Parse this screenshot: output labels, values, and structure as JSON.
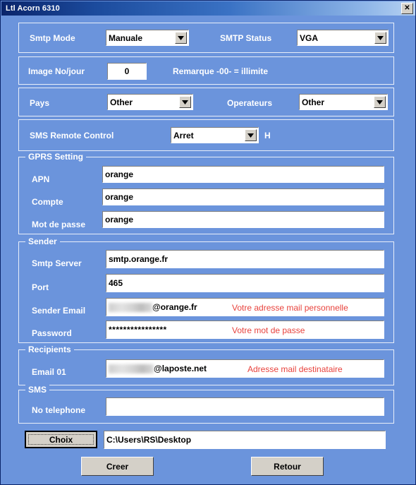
{
  "window": {
    "title": "Ltl Acorn 6310",
    "close_label": "✕",
    "bg_color": "#6b94dc",
    "accent_red": "#e8423c"
  },
  "smtp_mode": {
    "label": "Smtp Mode",
    "value": "Manuale"
  },
  "smtp_status": {
    "label": "SMTP Status",
    "value": "VGA"
  },
  "image_per_day": {
    "label": "Image No/jour",
    "value": "0",
    "remark": "Remarque -00- = illimite"
  },
  "pays": {
    "label": "Pays",
    "value": "Other"
  },
  "operateurs": {
    "label": "Operateurs",
    "value": "Other"
  },
  "sms_remote": {
    "label": "SMS Remote Control",
    "value": "Arret",
    "unit": "H"
  },
  "gprs": {
    "caption": "GPRS Setting",
    "apn": {
      "label": "APN",
      "value": "orange"
    },
    "compte": {
      "label": "Compte",
      "value": "orange"
    },
    "mot_de_passe": {
      "label": "Mot de passe",
      "value": "orange"
    }
  },
  "sender": {
    "caption": "Sender",
    "smtp_server": {
      "label": "Smtp Server",
      "value": "smtp.orange.fr"
    },
    "port": {
      "label": "Port",
      "value": "465"
    },
    "sender_email": {
      "label": "Sender Email",
      "value": "@orange.fr",
      "hint": "Votre adresse mail personnelle"
    },
    "password": {
      "label": "Password",
      "value": "****************",
      "hint": "Votre mot de passe"
    }
  },
  "recipients": {
    "caption": "Recipients",
    "email01": {
      "label": "Email 01",
      "value": "@laposte.net",
      "hint": "Adresse mail destinataire"
    }
  },
  "sms": {
    "caption": "SMS",
    "phone": {
      "label": "No telephone",
      "value": ""
    }
  },
  "path": {
    "choix_label": "Choix",
    "value": "C:\\Users\\RS\\Desktop"
  },
  "actions": {
    "creer_label": "Creer",
    "retour_label": "Retour"
  }
}
